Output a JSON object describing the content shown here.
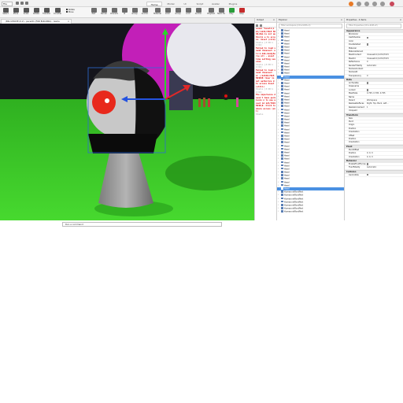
{
  "topbar": {
    "file_label": "File",
    "tabs": [
      "Home",
      "Model",
      "UI",
      "Script",
      "Avatar",
      "Plugins"
    ],
    "active_tab": "Home"
  },
  "toolbar": {
    "tools": [
      "Select",
      "Move",
      "Scale",
      "Rotate",
      "Transform",
      "Constraints"
    ],
    "snap_labels": [
      "Rotate",
      "Move"
    ],
    "tools_right": [
      "Part",
      "Terrain",
      "Character",
      "UI",
      "Group",
      "Anchor",
      "Material",
      "Color",
      "Group",
      "Lock",
      "Anchor",
      "Playtest",
      "Team Test",
      "Play",
      "Stop"
    ]
  },
  "doc_tab": {
    "title": "(BIG UPDATE (0.2) - pecer01 (FOR BUILDING) - Game",
    "close": "×"
  },
  "command_bar": {
    "placeholder": "Run a command"
  },
  "output": {
    "title": "Output",
    "lines": [
      {
        "kind": "err",
        "text": "sound \"Assets\\i ml//1234/7015 5040-Hmm is not authoriz e to access. Asset (cold)"
      },
      {
        "kind": "info",
        "text": "Studio [3:38:1 4:19]"
      },
      {
        "kind": "err",
        "text": "Failed to load sound rbxasset: ull:1.2mb-JunkyServe ull - asset line setting session."
      },
      {
        "kind": "info",
        "text": "Studio [3:38:1 4:19]"
      },
      {
        "kind": "err",
        "text": "Failed to load sound rbxasset: d: //12340/7015 504048: User is not authorize d to access Asset (still)"
      },
      {
        "kind": "info",
        "text": "Studio [3:38:1 4:19]"
      },
      {
        "kind": "err",
        "text": "The experience doesn't have permissio n to use asset id 123/7015 5040(0. Click to share access (all)"
      },
      {
        "kind": "info",
        "text": "Studio"
      }
    ]
  },
  "explorer": {
    "title": "Explorer",
    "filter_placeholder": "Filter workspace (Ctrl+Shift+X)",
    "items": [
      {
        "label": "Head",
        "selected": false
      },
      {
        "label": "Head",
        "selected": false
      },
      {
        "label": "Head",
        "selected": false
      },
      {
        "label": "Head",
        "selected": false
      },
      {
        "label": "Head",
        "selected": false
      },
      {
        "label": "Head",
        "selected": false
      },
      {
        "label": "Head",
        "selected": false
      },
      {
        "label": "Head",
        "selected": false
      },
      {
        "label": "Head",
        "selected": false
      },
      {
        "label": "Head",
        "selected": false
      },
      {
        "label": "Head",
        "selected": false
      },
      {
        "label": "Head",
        "selected": false
      },
      {
        "label": "Head",
        "selected": false
      },
      {
        "label": "Head",
        "selected": false
      },
      {
        "label": "Head",
        "selected": true
      },
      {
        "label": "Head",
        "selected": false
      },
      {
        "label": "Head",
        "selected": false
      },
      {
        "label": "Head",
        "selected": false
      },
      {
        "label": "Head",
        "selected": false
      },
      {
        "label": "Head",
        "selected": false
      },
      {
        "label": "Head",
        "selected": false
      },
      {
        "label": "Head",
        "selected": false
      },
      {
        "label": "Head",
        "selected": false
      },
      {
        "label": "Head",
        "selected": false
      },
      {
        "label": "Head",
        "selected": false
      },
      {
        "label": "Head",
        "selected": false
      },
      {
        "label": "Head",
        "selected": false
      },
      {
        "label": "Head",
        "selected": false
      },
      {
        "label": "Head",
        "selected": false
      },
      {
        "label": "Head",
        "selected": false
      },
      {
        "label": "Head",
        "selected": false
      },
      {
        "label": "Head",
        "selected": false
      },
      {
        "label": "Head",
        "selected": false
      },
      {
        "label": "Head",
        "selected": false
      },
      {
        "label": "Head",
        "selected": false
      },
      {
        "label": "Head",
        "selected": false
      },
      {
        "label": "Head",
        "selected": false
      },
      {
        "label": "Head",
        "selected": false
      },
      {
        "label": "Head",
        "selected": false
      },
      {
        "label": "Head",
        "selected": false
      },
      {
        "label": "Head",
        "selected": false
      },
      {
        "label": "Head",
        "selected": false
      },
      {
        "label": "Head",
        "selected": false
      },
      {
        "label": "Head",
        "selected": false
      },
      {
        "label": "Head",
        "selected": false
      },
      {
        "label": "Head",
        "selected": false
      },
      {
        "label": "Head",
        "selected": false
      },
      {
        "label": "Head",
        "selected": false
      },
      {
        "label": "Head",
        "selected": true
      },
      {
        "label": "HumanoidRootPart",
        "selected": false
      },
      {
        "label": "HumanoidRootPart",
        "selected": false
      },
      {
        "label": "HumanoidRootPart",
        "selected": false
      },
      {
        "label": "HumanoidRootPart",
        "selected": false
      },
      {
        "label": "HumanoidRootPart",
        "selected": false
      },
      {
        "label": "HumanoidRootPart",
        "selected": false
      },
      {
        "label": "HumanoidRootPart",
        "selected": false
      }
    ]
  },
  "properties": {
    "title": "Properties - 4 items",
    "filter_placeholder": "Filter Properties (Ctrl+Shift+P)",
    "sections": [
      {
        "name": "Appearance",
        "props": [
          {
            "k": "BrickColor",
            "v": ""
          },
          {
            "k": "CastShadow",
            "v": "",
            "check": false
          },
          {
            "k": "Color",
            "v": ""
          },
          {
            "k": "DoubleSided",
            "v": "",
            "check": false
          },
          {
            "k": "Material",
            "v": ""
          },
          {
            "k": "MaterialVariant",
            "v": ""
          },
          {
            "k": "MeshContent",
            "v": "rbxassetid://1234/7015"
          },
          {
            "k": "MeshId",
            "v": "rbxassetid://1234/7015"
          },
          {
            "k": "Reflectance",
            "v": "0"
          },
          {
            "k": "RenderFidelity",
            "v": "Automatic"
          },
          {
            "k": "TextureContent",
            "v": ""
          },
          {
            "k": "TextureID",
            "v": ""
          },
          {
            "k": "Transparency",
            "v": "0"
          }
        ]
      },
      {
        "name": "Data",
        "props": [
          {
            "k": "Archivable",
            "v": "",
            "check": true
          },
          {
            "k": "Classname",
            "v": ""
          },
          {
            "k": "Locked",
            "v": "",
            "check": false
          },
          {
            "k": "MeshSize",
            "v": "0.795, 0.795, 0.795"
          },
          {
            "k": "Name",
            "v": ""
          },
          {
            "k": "Parent",
            "v": "Workspace"
          },
          {
            "k": "ResizeableFaces",
            "v": "Right, Top, Back, Left..."
          },
          {
            "k": "ResizeIncrement",
            "v": "1"
          },
          {
            "k": "UniqueId",
            "v": ""
          }
        ]
      },
      {
        "name": "Transform",
        "props": [
          {
            "k": "Size",
            "v": ""
          },
          {
            "k": "Pivot",
            "v": ""
          },
          {
            "k": "Origin",
            "v": ""
          },
          {
            "k": "Position",
            "v": ""
          },
          {
            "k": "Orientation",
            "v": ""
          },
          {
            "k": "Offset",
            "v": ""
          },
          {
            "k": "Position",
            "v": ""
          },
          {
            "k": "Orientation",
            "v": ""
          }
        ]
      },
      {
        "name": "Pivot",
        "props": [
          {
            "k": "PivotOffset",
            "v": ""
          },
          {
            "k": "Position",
            "v": "0, 0, 0"
          },
          {
            "k": "Orientation",
            "v": "0, 0, 0"
          }
        ]
      },
      {
        "name": "Behavior",
        "props": [
          {
            "k": "EnableFluidForces",
            "v": "",
            "check": true
          },
          {
            "k": "FluidFidelity",
            "v": "Automatic"
          }
        ]
      },
      {
        "name": "Collision",
        "props": [
          {
            "k": "CanCollide",
            "v": "",
            "check": false
          }
        ]
      }
    ]
  },
  "colors": {
    "grass": "#3fcf2b",
    "sky": "#1b1b22",
    "accent_red": "#e8291c",
    "select_blue": "#4a90e2",
    "error_red": "#e00000"
  }
}
